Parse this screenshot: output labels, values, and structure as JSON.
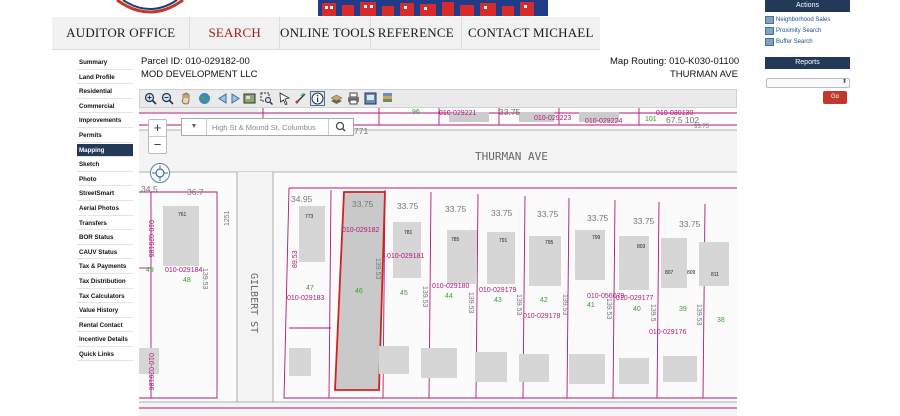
{
  "header": {
    "nav": [
      {
        "label": "AUDITOR OFFICE",
        "active": false
      },
      {
        "label": "SEARCH",
        "active": true
      },
      {
        "label": "ONLINE TOOLS",
        "active": false
      },
      {
        "label": "REFERENCE",
        "active": false
      },
      {
        "label": "CONTACT MICHAEL",
        "active": false
      }
    ]
  },
  "right_panel": {
    "actions_title": "Actions",
    "links": [
      "Neighborhood Sales",
      "Proximity Search",
      "Buffer Search"
    ],
    "reports_title": "Reports",
    "go_label": "Go"
  },
  "left_menu": {
    "active": "Mapping",
    "items": [
      "Summary",
      "Land Profile",
      "Residential",
      "Commercial",
      "Improvements",
      "Permits",
      "Mapping",
      "Sketch",
      "Photo",
      "StreetSmart",
      "Aerial Photos",
      "Transfers",
      "BOR Status",
      "CAUV Status",
      "Tax & Payments",
      "Tax Distribution",
      "Tax Calculators",
      "Value History",
      "Rental Contact",
      "Incentive Details",
      "Quick Links"
    ]
  },
  "parcel": {
    "id_line": "Parcel ID: 010-029182-00",
    "owner": "MOD DEVELOPMENT LLC",
    "routing_line": "Map Routing: 010-K030-01100",
    "street": "THURMAN AVE"
  },
  "map": {
    "search_placeholder": "High St & Mound St, Columbus",
    "zoom_in": "+",
    "zoom_out": "−",
    "streets": {
      "thurman": "THURMAN AVE",
      "gilbert": "GILBERT ST"
    },
    "highlight_parcel": "010-029182",
    "top_labels": [
      "96",
      "010-029221",
      "33.75",
      "010-029223",
      "010-029224",
      "010-030130",
      "101",
      "67.5 102",
      "33.75",
      "771"
    ],
    "frontages": [
      "34.95",
      "33.75",
      "33.75",
      "33.75",
      "33.75",
      "33.75",
      "33.75",
      "33.75",
      "33.75",
      "36.7",
      "34.5"
    ],
    "parcel_ids": [
      "010-029182",
      "010-029181",
      "010-029180",
      "010-029179",
      "010-029178",
      "010-056079",
      "010-029177",
      "010-029176",
      "010-029183",
      "010-029184",
      "010-029185",
      "010-029186"
    ],
    "lot_numbers": [
      "47",
      "46",
      "45",
      "44",
      "43",
      "42",
      "41",
      "40",
      "39",
      "38",
      "48",
      "49"
    ],
    "depths": [
      "89.53",
      "139.53",
      "139.53",
      "139.53",
      "139.53",
      "139.53",
      "139.53",
      "139.5",
      "139.53",
      "139.53",
      "1251"
    ],
    "house_numbers": [
      "773",
      "781",
      "785",
      "791",
      "795",
      "799",
      "803",
      "807",
      "809",
      "811",
      "761"
    ]
  },
  "colors": {
    "nav_active": "#b01818",
    "menu_active": "#223a57",
    "parcel_line": "#b2187a",
    "highlight_fill": "#c9c9c9",
    "highlight_stroke": "#d62020"
  }
}
